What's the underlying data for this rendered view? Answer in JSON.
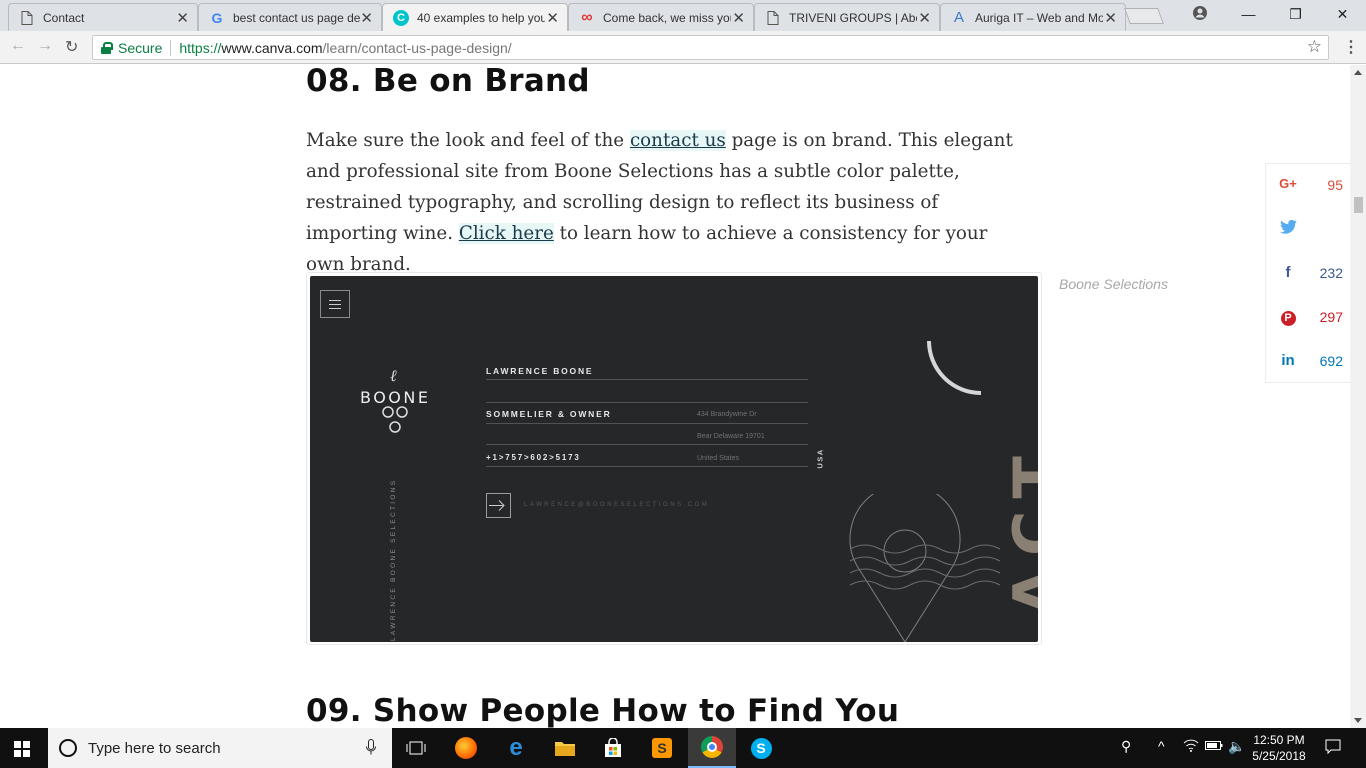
{
  "browser": {
    "tabs": [
      {
        "title": "Contact",
        "icon": "page-icon"
      },
      {
        "title": "best contact us page de",
        "icon": "google-icon"
      },
      {
        "title": "40 examples to help you",
        "icon": "canva-icon"
      },
      {
        "title": "Come back, we miss you",
        "icon": "infinity-icon"
      },
      {
        "title": "TRIVENI GROUPS | Abou",
        "icon": "page-icon"
      },
      {
        "title": "Auriga IT – Web and Mo",
        "icon": "auriga-icon"
      }
    ],
    "active_tab": 2,
    "secure_label": "Secure",
    "url_scheme": "https://",
    "url_host": "www.canva.com",
    "url_path": "/learn/contact-us-page-design/"
  },
  "article": {
    "heading_08": "08. Be on Brand",
    "para_1": "Make sure the look and feel of the ",
    "link_contact": "contact us",
    "para_2": " page is on brand. This elegant and professional site from Boone Selections has a subtle color palette, restrained typography, and scrolling design to reflect its business of importing wine.  ",
    "link_click": "Click here",
    "para_3": " to learn how to achieve a consistency for your own brand.",
    "caption": "Boone Selections",
    "heading_09": "09. Show People How to Find You"
  },
  "example_site": {
    "logo_mark": "ℓ",
    "logo_text": "BOONE",
    "name": "LAWRENCE BOONE",
    "role": "SOMMELIER & OWNER",
    "phone": "+1>757>602>5173",
    "address_1": "434 Brandywine Dr",
    "address_2": "Bear Delaware 19701",
    "address_3": "United States",
    "country": "USA",
    "email": "LAWRENCE@BOONESELECTIONS.COM",
    "vertical_text": "LAWRENCE BOONE SELECTIONS",
    "big_letters": "ACT"
  },
  "share": [
    {
      "network": "google-plus",
      "glyph": "G+",
      "count": "95",
      "color": "#dd4b39"
    },
    {
      "network": "twitter",
      "glyph": "🐦",
      "count": "",
      "color": "#55acee"
    },
    {
      "network": "facebook",
      "glyph": "f",
      "count": "232",
      "color": "#3b5998"
    },
    {
      "network": "pinterest",
      "glyph": "P",
      "count": "297",
      "color": "#cb2027"
    },
    {
      "network": "linkedin",
      "glyph": "in",
      "count": "692",
      "color": "#0077b5"
    }
  ],
  "taskbar": {
    "search_placeholder": "Type here to search",
    "time": "12:50 PM",
    "date": "5/25/2018"
  }
}
